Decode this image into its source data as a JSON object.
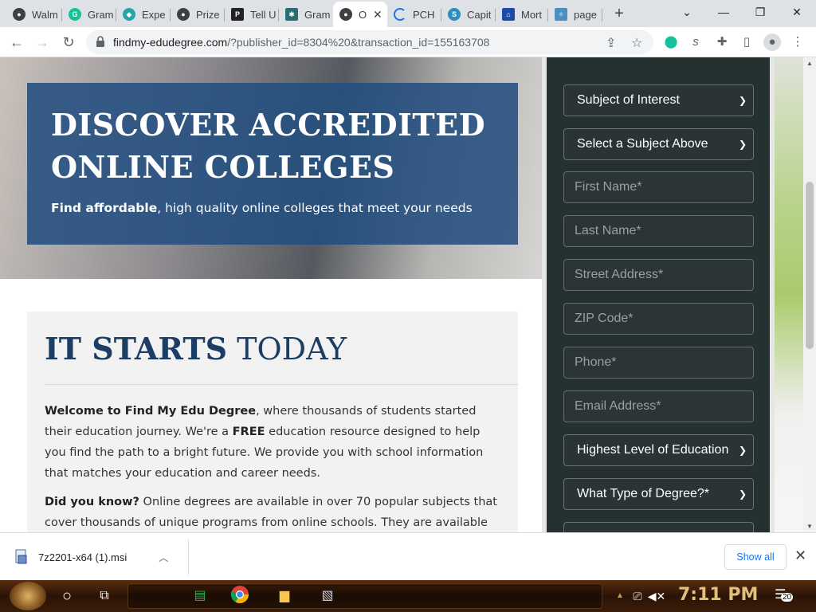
{
  "browser": {
    "tabs": [
      {
        "title": "Walm",
        "color": "#3c4043"
      },
      {
        "title": "Gram",
        "color": "#15c39a"
      },
      {
        "title": "Expe",
        "color": "#23a6a6"
      },
      {
        "title": "Prize",
        "color": "#3c4043"
      },
      {
        "title": "Tell U",
        "color": "#222222"
      },
      {
        "title": "Gram",
        "color": "#2a6f6f"
      },
      {
        "title": "O",
        "color": "#3c4043"
      },
      {
        "title": "PCH",
        "color": "#1a73e8"
      },
      {
        "title": "Capit",
        "color": "#2a8fbd"
      },
      {
        "title": "Mort",
        "color": "#1e4aa8"
      },
      {
        "title": "page",
        "color": "#4a90c2"
      }
    ],
    "active_tab_index": 6,
    "new_tab_label": "+",
    "window_controls": {
      "minimize": "—",
      "restore": "❐",
      "close": "✕",
      "tabsearch": "⌄"
    },
    "url_host": "findmy-edudegree.com",
    "url_path": "/?publisher_id=8304%20&transaction_id=155163708",
    "extension_icon_badge": "s"
  },
  "hero": {
    "title_line1": "DISCOVER ACCREDITED",
    "title_line2": "ONLINE COLLEGES",
    "subtitle_bold": "Find affordable",
    "subtitle_rest": ", high quality online colleges that meet your needs"
  },
  "section": {
    "heading_bold": "IT STARTS",
    "heading_rest": " TODAY",
    "p1_bold": "Welcome to Find My Edu Degree",
    "p1_a": ", where thousands of students started their education journey. We're a ",
    "p1_bold2": "FREE",
    "p1_b": " education resource designed to help you find the path to a bright future. We provide you with school information that matches your education and career needs.",
    "p2_bold": "Did you know?",
    "p2_rest": " Online degrees are available in over 70 popular subjects that cover thousands of unique programs from online schools. They are available at"
  },
  "form": {
    "subject": "Subject of Interest",
    "subject_sub": "Select a Subject Above",
    "first_name": "First Name*",
    "last_name": "Last Name*",
    "street": "Street Address*",
    "zip": "ZIP Code*",
    "phone": "Phone*",
    "email": "Email Address*",
    "education": "Highest Level of Education",
    "degree_type": "What Type of Degree?*"
  },
  "download": {
    "file_name": "7z2201-x64 (1).msi",
    "show_all": "Show all"
  },
  "taskbar": {
    "time": "7:11 PM",
    "notifications": "20"
  }
}
